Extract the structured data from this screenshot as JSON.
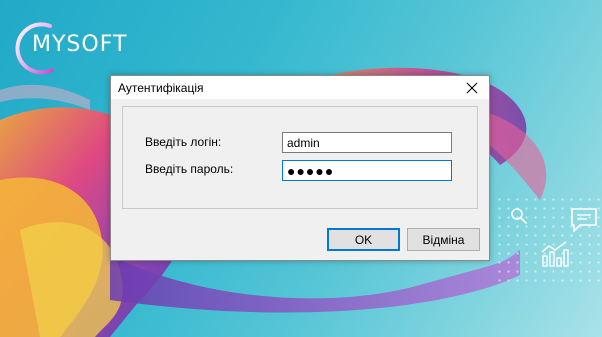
{
  "brand": {
    "logo_text": "MYSOFT"
  },
  "dialog": {
    "title": "Аутентифікація",
    "login_label": "Введіть логін:",
    "login_value": "admin",
    "password_label": "Введіть пароль:",
    "password_value": "●●●●●",
    "ok_label": "OK",
    "cancel_label": "Відміна"
  },
  "icons": {
    "close": "close-icon",
    "background": [
      "search-icon",
      "chat-icon",
      "bar-chart-icon"
    ]
  },
  "colors": {
    "background_teal": "#21a9c7",
    "accent_blue": "#0078d7",
    "dialog_bg": "#f0f0f0"
  }
}
